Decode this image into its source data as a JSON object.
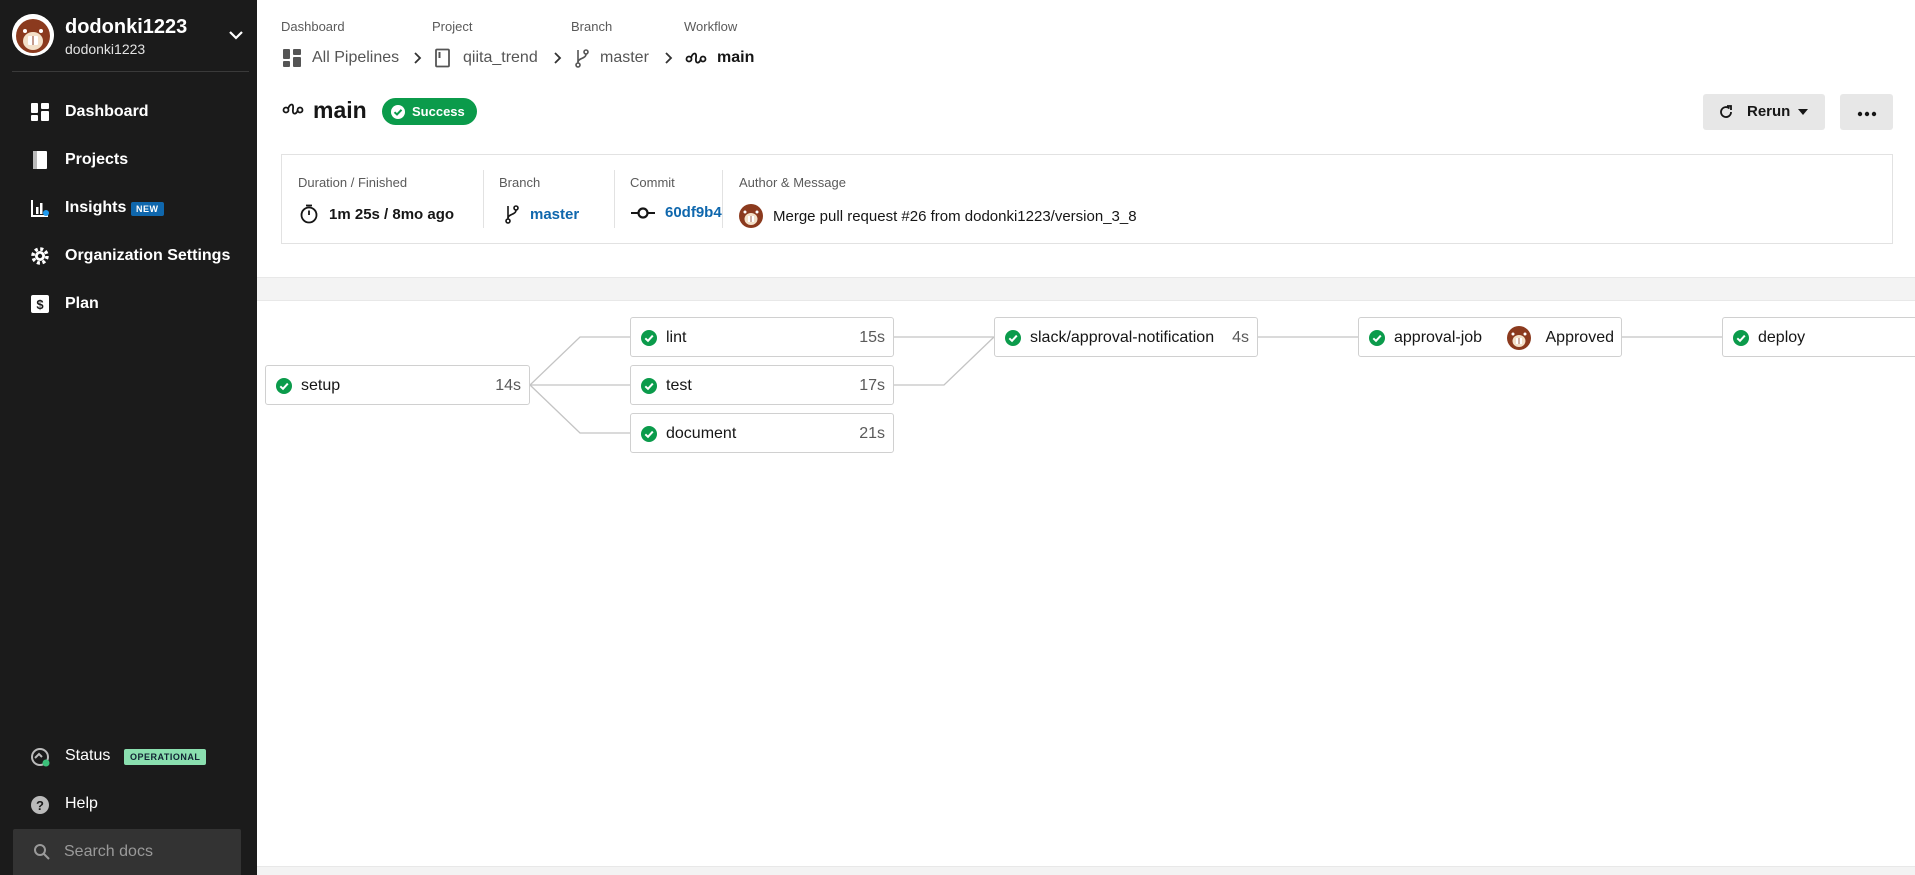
{
  "org": {
    "name": "dodonki1223",
    "subname": "dodonki1223"
  },
  "sidebar": {
    "items": [
      {
        "label": "Dashboard",
        "icon": "dashboard-icon"
      },
      {
        "label": "Projects",
        "icon": "projects-icon"
      },
      {
        "label": "Insights",
        "icon": "insights-icon",
        "badge": "NEW"
      },
      {
        "label": "Organization Settings",
        "icon": "gear-icon"
      },
      {
        "label": "Plan",
        "icon": "dollar-icon"
      }
    ],
    "status": {
      "label": "Status",
      "badge": "OPERATIONAL"
    },
    "help": {
      "label": "Help"
    },
    "search": {
      "placeholder": "Search docs"
    }
  },
  "breadcrumb": [
    {
      "label": "Dashboard",
      "value": "All Pipelines",
      "icon": "pipelines-icon"
    },
    {
      "label": "Project",
      "value": "qiita_trend",
      "icon": "repo-icon"
    },
    {
      "label": "Branch",
      "value": "master",
      "icon": "branch-icon"
    },
    {
      "label": "Workflow",
      "value": "main",
      "icon": "workflow-icon"
    }
  ],
  "header": {
    "title": "main",
    "status": "Success",
    "rerun_label": "Rerun"
  },
  "info": {
    "duration": {
      "label": "Duration / Finished",
      "value": "1m 25s / 8mo ago"
    },
    "branch": {
      "label": "Branch",
      "value": "master"
    },
    "commit": {
      "label": "Commit",
      "value": "60df9b4"
    },
    "author": {
      "label": "Author & Message",
      "value": "Merge pull request #26 from dodonki1223/version_3_8"
    }
  },
  "jobs": {
    "setup": {
      "name": "setup",
      "duration": "14s"
    },
    "lint": {
      "name": "lint",
      "duration": "15s"
    },
    "test": {
      "name": "test",
      "duration": "17s"
    },
    "document": {
      "name": "document",
      "duration": "21s"
    },
    "slack": {
      "name": "slack/approval-notification",
      "duration": "4s"
    },
    "approval": {
      "name": "approval-job",
      "status": "Approved"
    },
    "deploy": {
      "name": "deploy"
    }
  },
  "colors": {
    "success": "#0b9b4b",
    "link": "#0f67ad",
    "sidebar_bg": "#1b1b1b",
    "badge_new": "#0f67ad",
    "badge_operational": "#8adfaf"
  }
}
